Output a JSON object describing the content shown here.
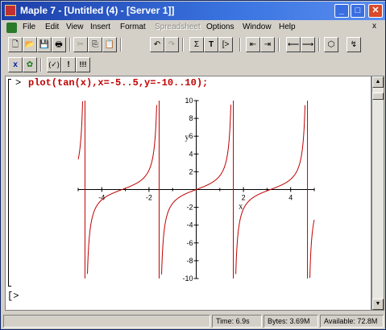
{
  "window": {
    "title": "Maple 7 - [Untitled (4) - [Server 1]]",
    "controls": {
      "minimize": "_",
      "maximize": "□",
      "close": "✕"
    }
  },
  "menu": {
    "items": [
      {
        "label": "File",
        "enabled": true
      },
      {
        "label": "Edit",
        "enabled": true
      },
      {
        "label": "View",
        "enabled": true
      },
      {
        "label": "Insert",
        "enabled": true
      },
      {
        "label": "Format",
        "enabled": true
      },
      {
        "label": "Spreadsheet",
        "enabled": false
      },
      {
        "label": "Options",
        "enabled": true
      },
      {
        "label": "Window",
        "enabled": true
      },
      {
        "label": "Help",
        "enabled": true
      }
    ],
    "close_doc": "x"
  },
  "toolbar1": {
    "buttons": [
      {
        "icon": "new-document-icon",
        "glyph": "🗋",
        "enabled": true
      },
      {
        "icon": "open-folder-icon",
        "glyph": "📂",
        "enabled": true
      },
      {
        "icon": "save-icon",
        "glyph": "💾",
        "enabled": true
      },
      {
        "icon": "print-icon",
        "glyph": "🖶",
        "enabled": true
      },
      {
        "icon": "cut-icon",
        "glyph": "✂",
        "enabled": false
      },
      {
        "icon": "copy-icon",
        "glyph": "⎘",
        "enabled": true
      },
      {
        "icon": "paste-icon",
        "glyph": "📋",
        "enabled": true
      },
      {
        "icon": "undo-icon",
        "glyph": "↶",
        "enabled": true
      },
      {
        "icon": "redo-icon",
        "glyph": "↷",
        "enabled": false
      },
      {
        "icon": "sigma-icon",
        "glyph": "Σ",
        "enabled": true
      },
      {
        "icon": "text-icon",
        "glyph": "T",
        "enabled": true
      },
      {
        "icon": "prompt-icon",
        "glyph": "[>",
        "enabled": true
      },
      {
        "icon": "outdent-icon",
        "glyph": "⇤",
        "enabled": true
      },
      {
        "icon": "indent-icon",
        "glyph": "⇥",
        "enabled": true
      },
      {
        "icon": "back-icon",
        "glyph": "⟵",
        "enabled": true
      },
      {
        "icon": "forward-icon",
        "glyph": "⟶",
        "enabled": true
      },
      {
        "icon": "stop-icon",
        "glyph": "⬡",
        "enabled": true
      },
      {
        "icon": "restart-icon",
        "glyph": "↯",
        "enabled": true
      }
    ]
  },
  "toolbar2": {
    "buttons": [
      {
        "icon": "math-input-icon",
        "glyph": "x",
        "enabled": true
      },
      {
        "icon": "maple-leaf-icon",
        "glyph": "✿",
        "enabled": true
      },
      {
        "icon": "execute-expression-icon",
        "glyph": "(✓)",
        "enabled": true
      },
      {
        "icon": "execute-selection-icon",
        "glyph": "!",
        "enabled": true
      },
      {
        "icon": "execute-worksheet-icon",
        "glyph": "!!!",
        "enabled": true
      }
    ]
  },
  "worksheet": {
    "prompt": ">",
    "command": "plot(tan(x),x=-5..5,y=-10..10);",
    "empty_prompt": "[>"
  },
  "chart_data": {
    "type": "line",
    "function": "tan(x)",
    "xlabel": "x",
    "ylabel": "y",
    "xlim": [
      -5,
      5
    ],
    "ylim": [
      -10,
      10
    ],
    "x_ticks": [
      -4,
      -2,
      2,
      4
    ],
    "y_ticks": [
      -10,
      -8,
      -6,
      -4,
      -2,
      2,
      4,
      6,
      8,
      10
    ],
    "x_tick_labels": [
      "-4",
      "-2",
      "2",
      "4"
    ],
    "y_tick_labels": [
      "-10",
      "-8",
      "-6",
      "-4",
      "-2",
      "2",
      "4",
      "6",
      "8",
      "10"
    ],
    "asymptotes": [
      -4.712,
      -1.571,
      1.571,
      4.712
    ],
    "line_color": "#c00000",
    "grid": false
  },
  "status": {
    "blank": "",
    "time": "Time: 6.9s",
    "bytes": "Bytes: 3.69M",
    "available": "Available: 72.8M"
  }
}
